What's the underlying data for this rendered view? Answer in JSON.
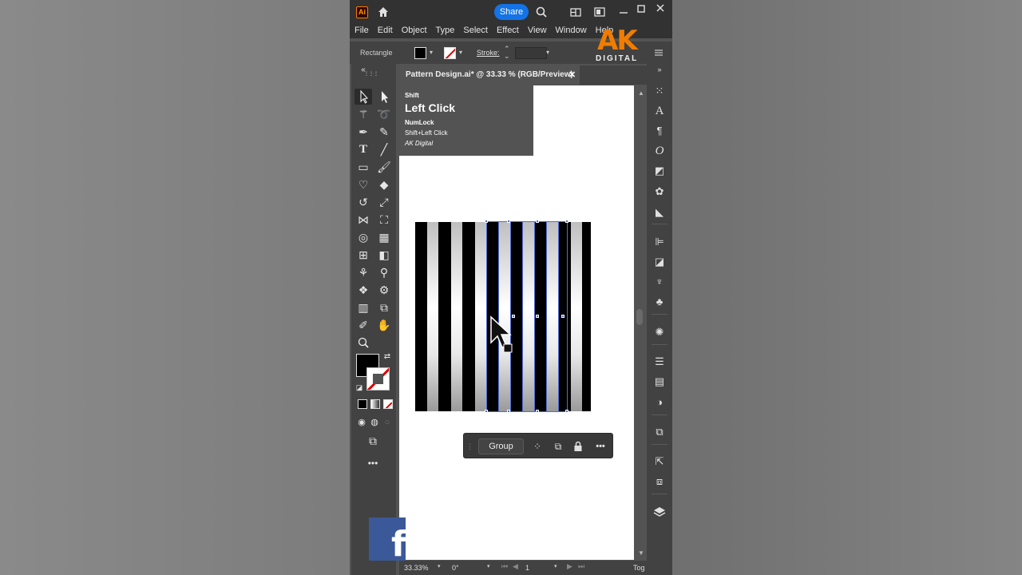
{
  "app": {
    "logo_text": "Ai",
    "share_label": "Share"
  },
  "menu": [
    "File",
    "Edit",
    "Object",
    "Type",
    "Select",
    "Effect",
    "View",
    "Window",
    "Help"
  ],
  "control_bar": {
    "object_type": "Rectangle",
    "stroke_label": "Stroke:",
    "stroke_value": ""
  },
  "watermark": {
    "letters": "AK",
    "sub": "DIGITAL"
  },
  "document": {
    "tab_title": "Pattern Design.ai* @ 33.33 % (RGB/Preview)",
    "close_glyph": "✕"
  },
  "tooltip": {
    "modifier": "Shift",
    "action": "Left Click",
    "line1": "NumLock",
    "line2": "Shift+Left Click",
    "credit": "AK Digital"
  },
  "context_bar": {
    "group_label": "Group"
  },
  "status_bar": {
    "zoom": "33.33%",
    "rotation": "0°",
    "artboard": "1",
    "toggle": "Tog"
  },
  "colors": {
    "accent": "#1473e6",
    "selection": "#4f6cd8",
    "brand_orange": "#f07c00",
    "facebook": "#3b5998"
  },
  "icons": {
    "home": "home-icon",
    "search": "search-icon",
    "arrange": "arrange-documents-icon",
    "selection": "selection-tool-icon",
    "hand": "hand-tool-icon",
    "zoom": "zoom-tool-icon",
    "layers": "layers-icon"
  }
}
